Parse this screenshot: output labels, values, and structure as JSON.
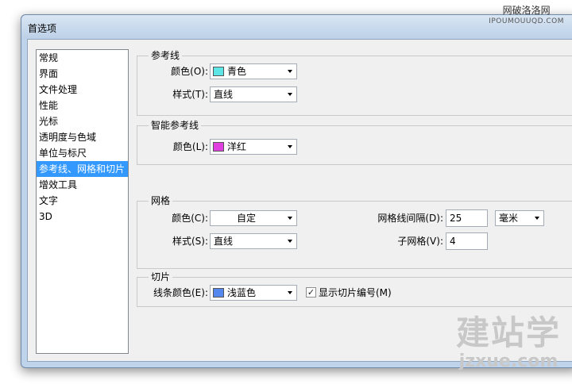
{
  "window": {
    "title": "首选项"
  },
  "sidebar": {
    "items": [
      {
        "label": "常规"
      },
      {
        "label": "界面"
      },
      {
        "label": "文件处理"
      },
      {
        "label": "性能"
      },
      {
        "label": "光标"
      },
      {
        "label": "透明度与色域"
      },
      {
        "label": "单位与标尺"
      },
      {
        "label": "参考线、网格和切片",
        "selected": true
      },
      {
        "label": "增效工具"
      },
      {
        "label": "文字"
      },
      {
        "label": "3D"
      }
    ]
  },
  "guides": {
    "legend": "参考线",
    "color_label": "颜色(O):",
    "color_value": "青色",
    "color_swatch": "#5ee6e6",
    "style_label": "样式(T):",
    "style_value": "直线"
  },
  "smart_guides": {
    "legend": "智能参考线",
    "color_label": "颜色(L):",
    "color_value": "洋红",
    "color_swatch": "#e040e0"
  },
  "grid": {
    "legend": "网格",
    "color_label": "颜色(C):",
    "color_value": "自定",
    "style_label": "样式(S):",
    "style_value": "直线",
    "gridline_label": "网格线间隔(D):",
    "gridline_value": "25",
    "unit_value": "毫米",
    "subdiv_label": "子网格(V):",
    "subdiv_value": "4"
  },
  "slices": {
    "legend": "切片",
    "line_color_label": "线条颜色(E):",
    "line_color_value": "浅蓝色",
    "line_color_swatch": "#5588ee",
    "show_numbers_label": "显示切片编号(M)",
    "show_numbers_checked": true
  },
  "watermarks": {
    "top_line1": "网破洛洛网",
    "top_line2": "IPOUMOUUQD.COM",
    "bottom_line1": "建站学",
    "bottom_line2": "jzxue.com"
  }
}
